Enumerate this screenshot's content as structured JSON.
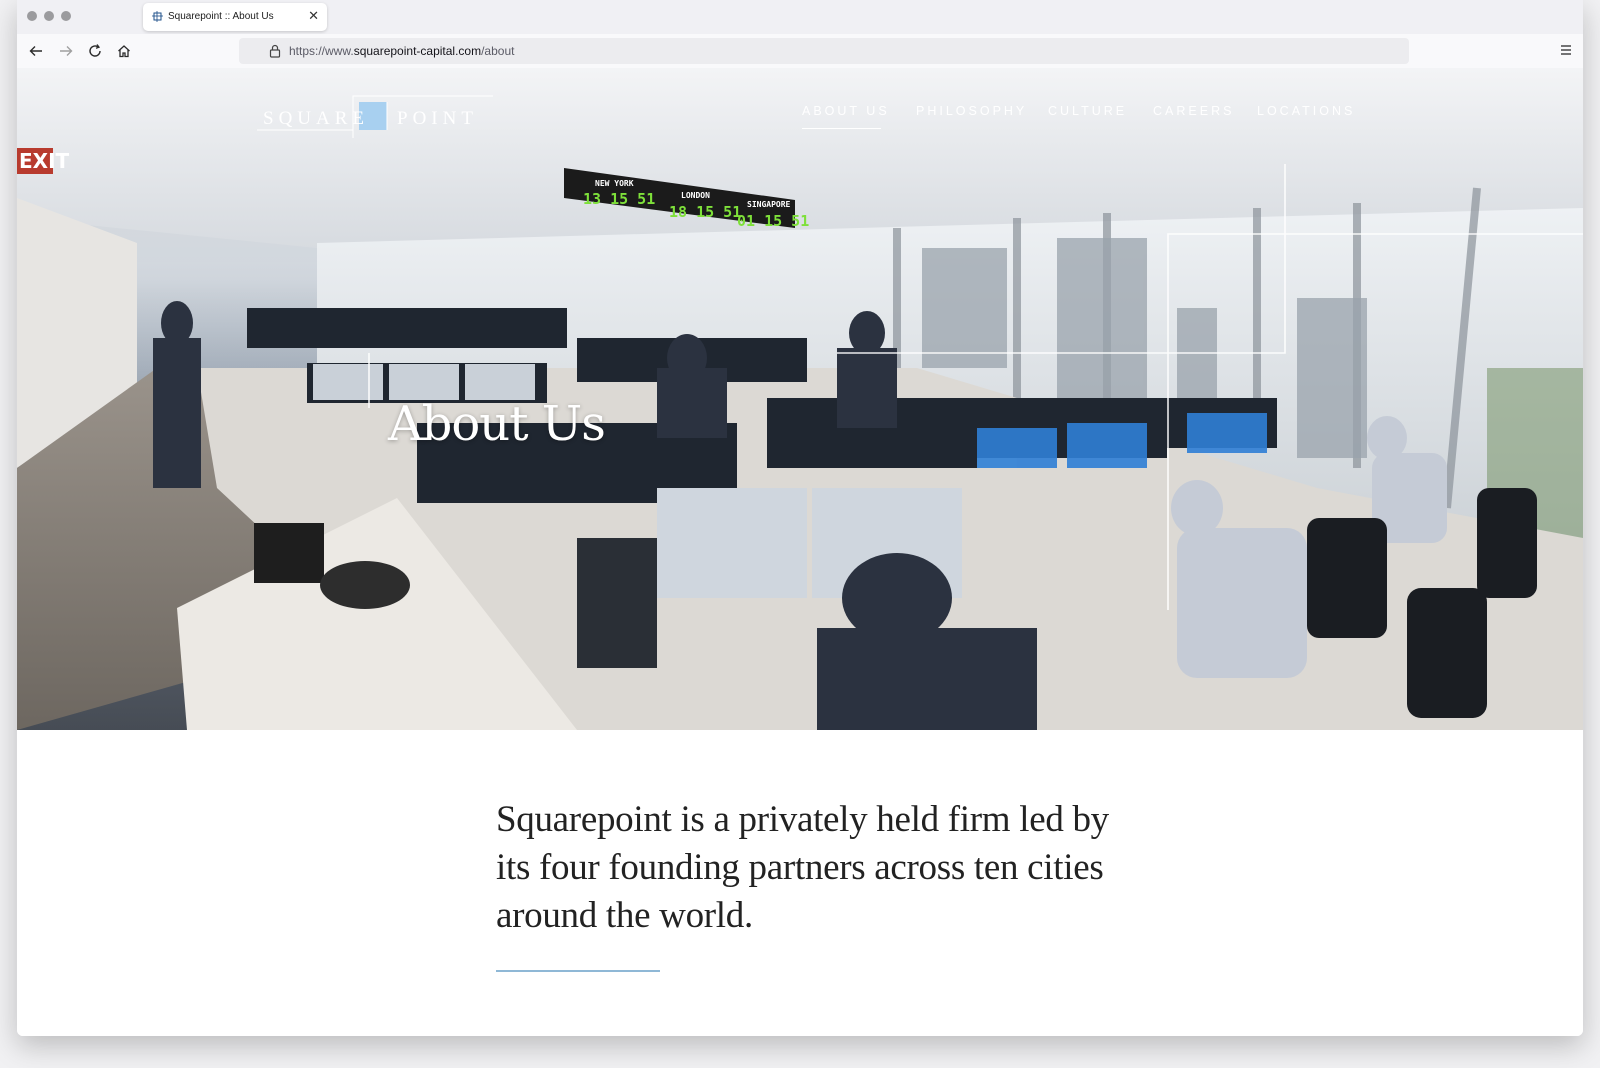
{
  "browser": {
    "tab_title": "Squarepoint :: About Us",
    "tab_close": "✕",
    "url_prefix": "https://www.",
    "url_domain": "squarepoint-capital.com",
    "url_path": "/about"
  },
  "site": {
    "logo_word_1": "SQUARE",
    "logo_word_2": "POINT",
    "nav": [
      {
        "label": "ABOUT US",
        "active": true
      },
      {
        "label": "PHILOSOPHY",
        "active": false
      },
      {
        "label": "CULTURE",
        "active": false
      },
      {
        "label": "CAREERS",
        "active": false
      },
      {
        "label": "LOCATIONS",
        "active": false
      }
    ]
  },
  "hero": {
    "title": "About Us",
    "clock_cities": [
      "NEW YORK",
      "LONDON",
      "SINGAPORE"
    ],
    "clock_times": [
      "13 15 51",
      "18 15 51",
      "01 15 51"
    ],
    "exit_sign": "EXIT"
  },
  "intro": {
    "lead": "Squarepoint is a privately held firm led by its four founding partners across ten cities around the world."
  },
  "colors": {
    "accent": "#8fb8d6",
    "logo_square": "#a8d0f0",
    "clock_digits": "#7ee03a"
  }
}
